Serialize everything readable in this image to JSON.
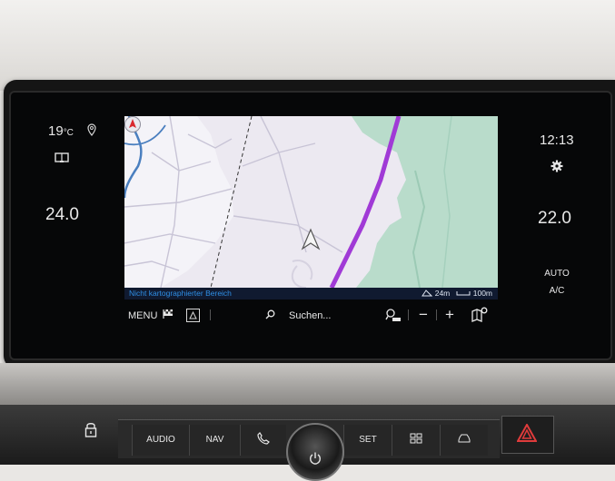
{
  "climate_left": {
    "outside_temp": "19",
    "outside_temp_unit": "°C",
    "set_temp": "24.0"
  },
  "climate_right": {
    "clock": "12:13",
    "set_temp": "22.0",
    "auto_label": "AUTO",
    "ac_label": "A/C"
  },
  "map": {
    "status_text": "Nicht kartographierter Bereich",
    "elevation": "24m",
    "scale": "100m"
  },
  "menubar": {
    "menu_label": "MENU",
    "search_label": "Suchen..."
  },
  "console": {
    "audio_label": "AUDIO",
    "nav_label": "NAV",
    "set_label": "SET"
  },
  "colors": {
    "route": "#a03ad6",
    "forest": "#b4d9c8",
    "water": "#4a7fbf",
    "status_text": "#2f8fe6"
  },
  "icons": {
    "location": "location-pin-icon",
    "book": "book-icon",
    "settings": "gear-icon",
    "destination": "checkered-flag-icon",
    "route_overview": "route-overview-icon",
    "search": "search-icon",
    "zoom_auto": "zoom-auto-icon",
    "map_settings": "map-settings-icon",
    "compass": "compass-icon",
    "lock": "lock-icon",
    "phone": "phone-icon",
    "power": "power-icon",
    "grid": "apps-grid-icon",
    "car": "car-icon",
    "hazard": "hazard-icon"
  }
}
